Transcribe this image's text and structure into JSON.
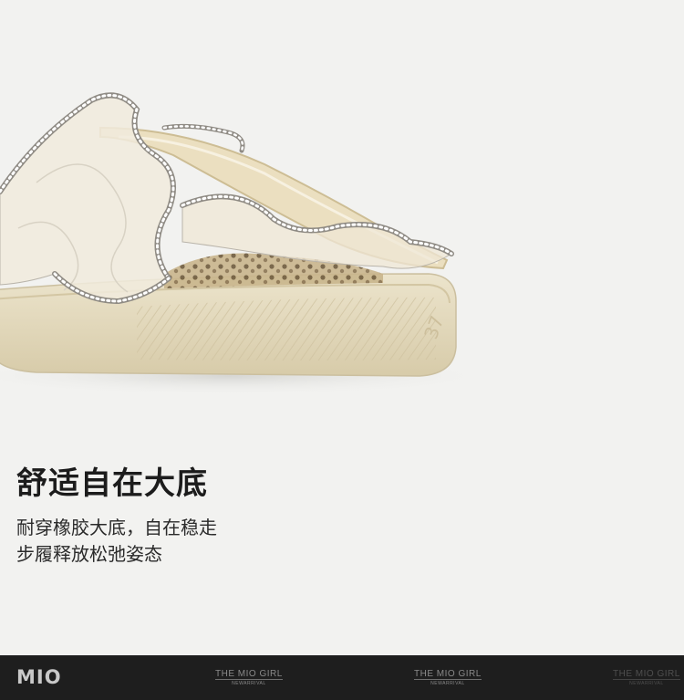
{
  "headline": "舒适自在大底",
  "description_lines": [
    "耐穿橡胶大底，自在稳走",
    "步履释放松弛姿态"
  ],
  "sole_size_marking": "37",
  "footer": {
    "brand_logo": "MIO",
    "watermarks": [
      {
        "title": "THE MIO GIRL",
        "subtitle": "NEWARRIVAL"
      },
      {
        "title": "THE MIO GIRL",
        "subtitle": "NEWARRIVAL"
      },
      {
        "title": "THE MIO GIRL",
        "subtitle": "NEWARRIVAL"
      }
    ]
  },
  "colors": {
    "background": "#f2f2f0",
    "sole": "#e6dcc1",
    "footer_bar": "#1e1e1e"
  }
}
